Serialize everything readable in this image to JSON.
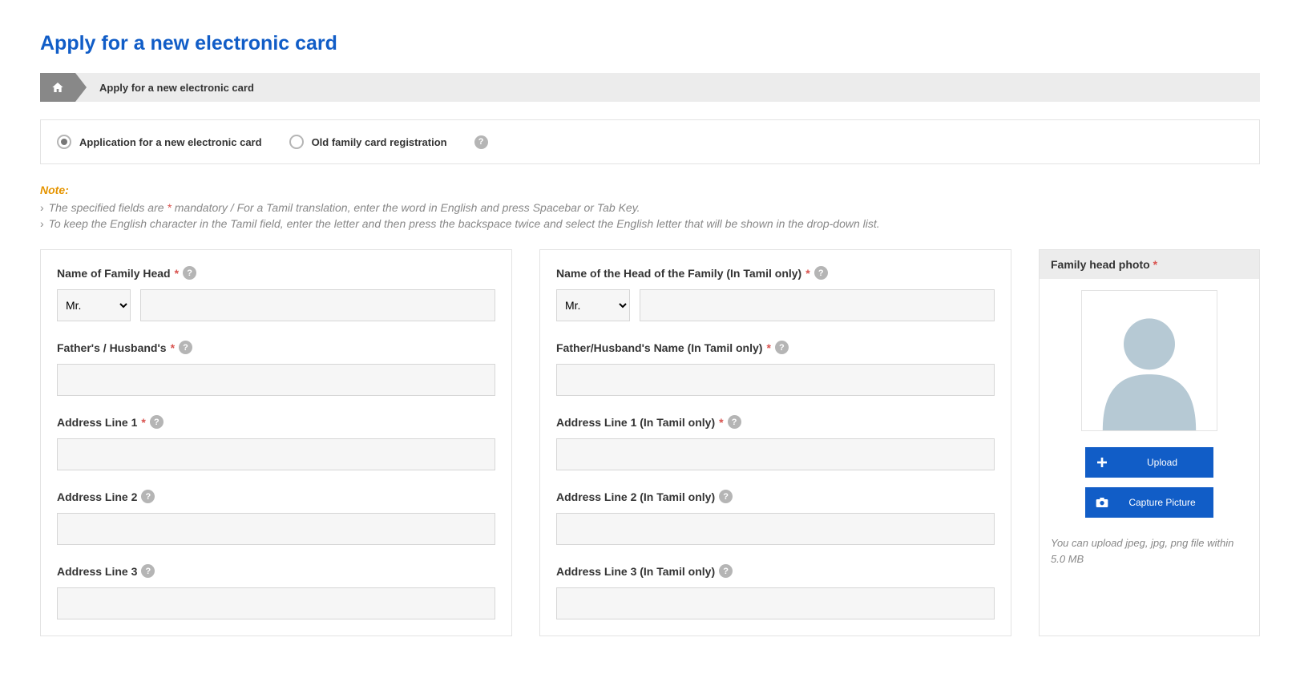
{
  "page_title": "Apply for a new electronic card",
  "breadcrumb": {
    "current": "Apply for a new electronic card"
  },
  "application_type": {
    "option_new": "Application for a new electronic card",
    "option_old": "Old family card registration",
    "selected": "new"
  },
  "notes": {
    "label": "Note:",
    "line1_prefix": "The specified fields are ",
    "line1_asterisk": "*",
    "line1_mid": " mandatory /  For a Tamil translation, enter the word in English and press Spacebar or Tab Key.",
    "line2": "To keep the English character in the Tamil field, enter the letter and then press the backspace twice and select the English letter that will be shown in the drop-down list."
  },
  "form_english": {
    "name_label": "Name of Family Head",
    "title_option": "Mr.",
    "father_label": "Father's / Husband's",
    "addr1_label": "Address Line 1",
    "addr2_label": "Address Line 2",
    "addr3_label": "Address Line 3"
  },
  "form_tamil": {
    "name_label": "Name of the Head of the Family (In Tamil only)",
    "title_option": "Mr.",
    "father_label": "Father/Husband's Name (In Tamil only)",
    "addr1_label": "Address Line 1 (In Tamil only)",
    "addr2_label": "Address Line 2 (In Tamil only)",
    "addr3_label": "Address Line 3 (In Tamil only)"
  },
  "photo": {
    "header": "Family head photo",
    "upload_label": "Upload",
    "capture_label": "Capture Picture",
    "note": "You can upload jpeg, jpg, png file within 5.0 MB"
  }
}
